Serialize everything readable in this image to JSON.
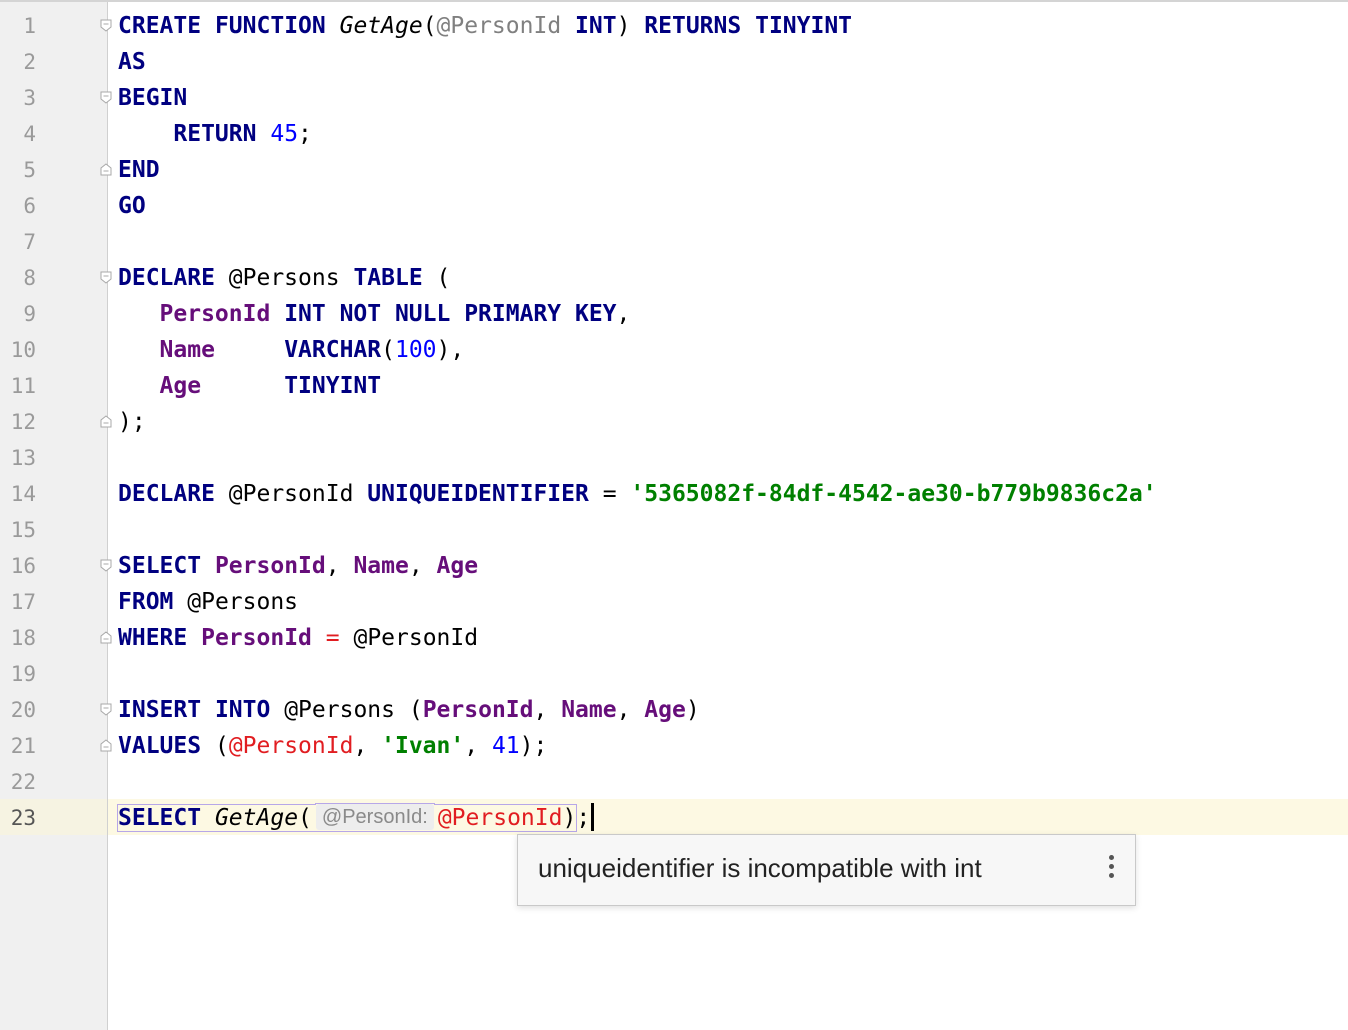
{
  "editor": {
    "line_numbers": [
      "1",
      "2",
      "3",
      "4",
      "5",
      "6",
      "7",
      "8",
      "9",
      "10",
      "11",
      "12",
      "13",
      "14",
      "15",
      "16",
      "17",
      "18",
      "19",
      "20",
      "21",
      "22",
      "23"
    ],
    "current_line": "23",
    "code": {
      "l1": {
        "create": "CREATE",
        "function": "FUNCTION",
        "fname": "GetAge",
        "lparen": "(",
        "param": "@PersonId",
        "int": "INT",
        "rparen": ")",
        "returns": "RETURNS",
        "tinyint": "TINYINT"
      },
      "l2": {
        "as": "AS"
      },
      "l3": {
        "begin": "BEGIN"
      },
      "l4": {
        "indent": "    ",
        "return": "RETURN",
        "num": "45",
        "semi": ";"
      },
      "l5": {
        "end": "END"
      },
      "l6": {
        "go": "GO"
      },
      "l8": {
        "declare": "DECLARE",
        "var": "@Persons",
        "table": "TABLE",
        "paren": "("
      },
      "l9": {
        "indent": "   ",
        "col": "PersonId",
        "def": "INT NOT NULL PRIMARY KEY",
        "comma": ","
      },
      "l10": {
        "indent": "   ",
        "col": "Name",
        "pad": "     ",
        "varchar": "VARCHAR",
        "lp": "(",
        "num": "100",
        "rp": "),"
      },
      "l11": {
        "indent": "   ",
        "col": "Age",
        "pad": "      ",
        "tinyint": "TINYINT"
      },
      "l12": {
        "close": ");"
      },
      "l14": {
        "declare": "DECLARE",
        "var": "@PersonId",
        "type": "UNIQUEIDENTIFIER",
        "eq": "=",
        "str": "'5365082f-84df-4542-ae30-b779b9836c2a'"
      },
      "l16": {
        "select": "SELECT",
        "c1": "PersonId",
        "c2": "Name",
        "c3": "Age",
        "comma": ", "
      },
      "l17": {
        "from": "FROM",
        "var": "@Persons"
      },
      "l18": {
        "where": "WHERE",
        "col": "PersonId",
        "eq": "=",
        "var": "@PersonId"
      },
      "l20": {
        "insert": "INSERT",
        "into": "INTO",
        "var": "@Persons",
        "lp": "(",
        "c1": "PersonId",
        "c2": "Name",
        "c3": "Age",
        "rp": ")",
        "comma": ", "
      },
      "l21": {
        "values": "VALUES",
        "lp": "(",
        "var": "@PersonId",
        "str": "'Ivan'",
        "num": "41",
        "rp": ");",
        "comma": ", "
      },
      "l23": {
        "select": "SELECT",
        "fname": "GetAge",
        "lp": "(",
        "hint": "@PersonId:",
        "var": "@PersonId",
        "rp": ")",
        "semi": ";"
      }
    }
  },
  "tooltip": {
    "message": "uniqueidentifier is incompatible with int",
    "more_icon": "vertical-ellipsis-icon"
  }
}
